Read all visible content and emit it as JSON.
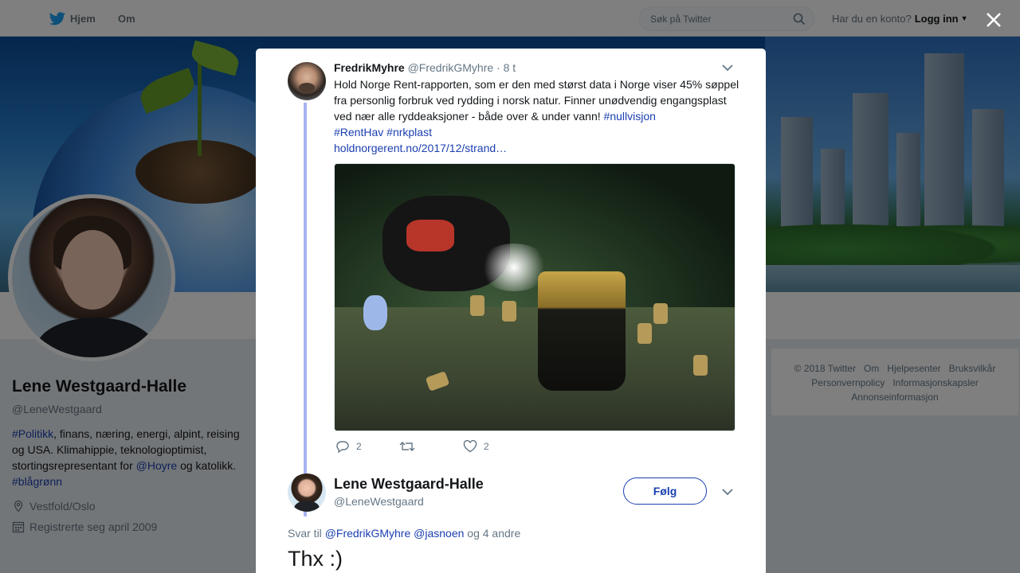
{
  "topbar": {
    "home_label": "Hjem",
    "about_label": "Om",
    "search_placeholder": "Søk på Twitter",
    "login_prompt": "Har du en konto?",
    "login_label": "Logg inn"
  },
  "profile": {
    "name": "Lene Westgaard-Halle",
    "handle": "@LeneWestgaard",
    "bio": {
      "tag_politics": "#Politikk",
      "text_1": ", finans, næring, energi, alpint, reising og USA. Klimahippie, teknologioptimist, stortingsrepresentant for ",
      "mention_hoyre": "@Hoyre",
      "text_2": " og katolikk. ",
      "tag_blagronn": "#blågrønn"
    },
    "location": "Vestfold/Oslo",
    "joined": "Registrerte seg april 2009"
  },
  "footer": {
    "copyright": "© 2018 Twitter",
    "about": "Om",
    "help": "Hjelpesenter",
    "terms": "Bruksvilkår",
    "privacy": "Personvernpolicy",
    "cookies": "Informasjonskapsler",
    "ads": "Annonseinformasjon"
  },
  "tweet": {
    "author_name": "FredrikMyhre",
    "author_handle": "@FredrikGMyhre",
    "time": "· 8 t",
    "text": "Hold Norge Rent-rapporten, som er den med størst data i Norge viser 45% søppel fra personlig forbruk ved rydding i norsk natur. Finner unødvendig engangsplast ved nær alle ryddeaksjoner - både over & under vann! ",
    "tag_nullvisjon": "#nullvisjon",
    "tag_renthav": "#RentHav",
    "tag_nrkplast": "#nrkplast",
    "link": "holdnorgerent.no/2017/12/strand…",
    "reply_count": "2",
    "retweet_count": "",
    "like_count": "2"
  },
  "reply": {
    "author_name": "Lene Westgaard-Halle",
    "author_handle": "@LeneWestgaard",
    "follow_label": "Følg",
    "reply_to_prefix": "Svar til",
    "reply_to_mention_1": "@FredrikGMyhre",
    "reply_to_mention_2": "@jasnoen",
    "reply_to_suffix": "og 4 andre",
    "text": "Thx :)"
  },
  "colors": {
    "link_blue": "#1b3fb0",
    "thread_line": "#a8b4f0",
    "twitter_blue": "#1da1f2"
  }
}
